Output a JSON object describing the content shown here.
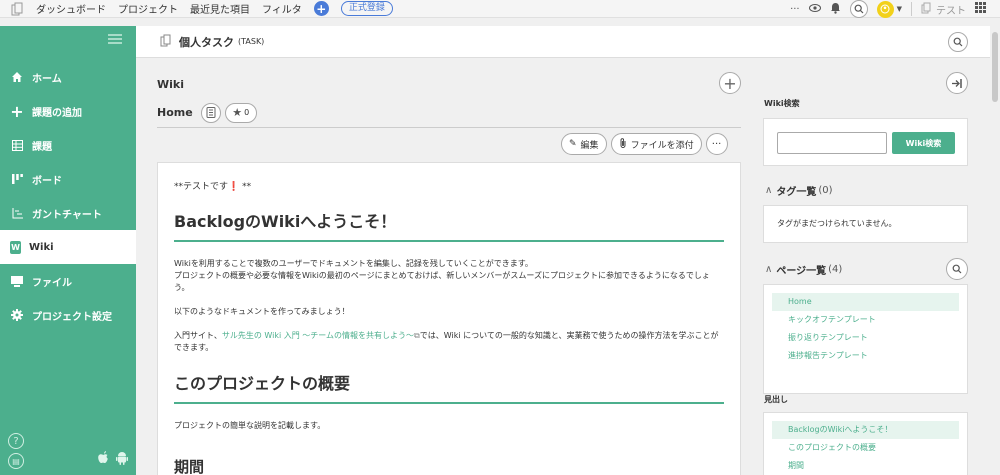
{
  "topbar": {
    "nav": [
      "ダッシュボード",
      "プロジェクト",
      "最近見た項目",
      "フィルタ"
    ],
    "register_label": "正式登録",
    "more_label": "···",
    "space_name": "テスト"
  },
  "sidebar": {
    "items": [
      {
        "label": "ホーム",
        "icon": "home-icon"
      },
      {
        "label": "課題の追加",
        "icon": "plus-icon"
      },
      {
        "label": "課題",
        "icon": "list-icon"
      },
      {
        "label": "ボード",
        "icon": "board-icon"
      },
      {
        "label": "ガントチャート",
        "icon": "gantt-icon"
      },
      {
        "label": "Wiki",
        "icon": "wiki-icon"
      },
      {
        "label": "ファイル",
        "icon": "folder-icon"
      },
      {
        "label": "プロジェクト設定",
        "icon": "gear-icon"
      }
    ],
    "active_index": 5,
    "help_label": "?"
  },
  "project": {
    "name": "個人タスク",
    "key": "(TASK)"
  },
  "wiki": {
    "section_title": "Wiki",
    "page_name": "Home",
    "star_count": "0",
    "edit_label": "編集",
    "attach_label": "ファイルを添付",
    "more_label": "···"
  },
  "content": {
    "line1_pre": "**テストです",
    "line1_mark": "❗",
    "line1_post": " **",
    "h_welcome": "BacklogのWikiへようこそ！",
    "p1_a": "Wikiを利用することで複数のユーザーでドキュメントを編集し、記録を残していくことができます。",
    "p1_b": "プロジェクトの概要や必要な情報をWikiの最初のページにまとめておけば、新しいメンバーがスムーズにプロジェクトに参加できるようになるでしょう。",
    "p2": "以下のようなドキュメントを作ってみましょう！",
    "p3_pre": "入門サイト、",
    "p3_link": "サル先生の Wiki 入門 〜チームの情報を共有しよう〜",
    "p3_post": "では、Wiki についての一般的な知識と、実業務で使うための操作方法を学ぶことができます。",
    "h_overview": "このプロジェクトの概要",
    "p4": "プロジェクトの簡単な説明を記載します。",
    "h_period": "期間"
  },
  "right": {
    "search_label": "Wiki検索",
    "search_button": "Wiki検索",
    "tags_label": "タグ一覧",
    "tags_count": "(0)",
    "tags_empty": "タグがまだつけられていません。",
    "pages_label": "ページ一覧",
    "pages_count": "(4)",
    "pages": [
      "Home",
      "キックオフテンプレート",
      "振り返りテンプレート",
      "進捗報告テンプレート"
    ],
    "headings_label": "見出し",
    "headings": [
      "BacklogのWikiへようこそ！",
      "このプロジェクトの概要",
      "期間"
    ]
  },
  "colors": {
    "brand": "#4caf8d",
    "accent_blue": "#4a7bd8",
    "alert_red": "#e02d2d"
  }
}
